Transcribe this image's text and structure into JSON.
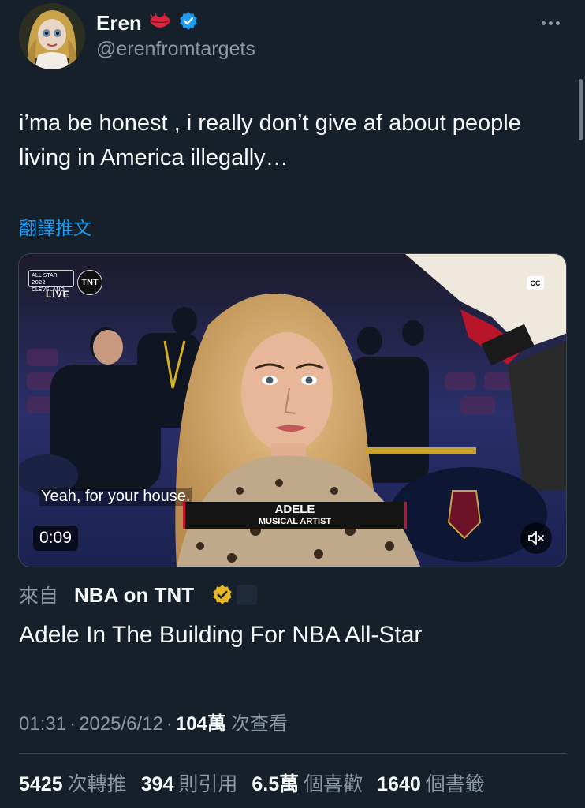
{
  "author": {
    "display_name": "Eren",
    "handle": "@erenfromtargets",
    "emoji_icon": "kiss-lips-icon",
    "verified_icon": "blue-verified-badge",
    "verified_color": "#1d9bf0"
  },
  "tweet": {
    "text": "i’ma be honest , i really don’t give af about people living in America illegally…",
    "translate_label": "翻譯推文"
  },
  "video": {
    "live_label": "LIVE",
    "event_badge": "ALL STAR 2022 CLEVELAND",
    "network_logo": "TNT",
    "cc_label": "CC",
    "caption": "Yeah, for your house.",
    "lower_third_name": "ADELE",
    "lower_third_role": "MUSICAL ARTIST",
    "time": "0:09",
    "mute_icon": "speaker-muted-icon"
  },
  "source": {
    "prefix": "來自",
    "name": "NBA on TNT",
    "badge": "gold-verified-badge",
    "badge_color": "#e8b829"
  },
  "video_title": "Adele In The Building For NBA All-Star",
  "meta": {
    "time": "01:31",
    "separator": "·",
    "date": "2025/6/12",
    "views": "104萬",
    "views_label": "次查看"
  },
  "stats": [
    {
      "value": "5425",
      "label": "次轉推"
    },
    {
      "value": "394",
      "label": "則引用"
    },
    {
      "value": "6.5萬",
      "label": "個喜歡"
    },
    {
      "value": "1640",
      "label": "個書籤"
    }
  ]
}
